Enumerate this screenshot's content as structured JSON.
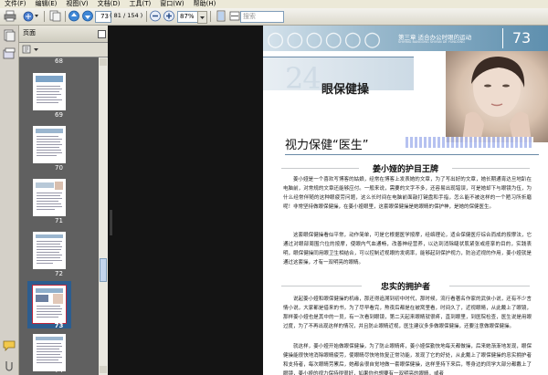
{
  "menu": [
    "文件(F)",
    "编辑(E)",
    "视图(V)",
    "文档(D)",
    "工具(T)",
    "窗口(W)",
    "帮助(H)"
  ],
  "toolbar": {
    "page_value": "73",
    "page_total": "( 81 / 154 )",
    "zoom_value": "87%",
    "search_placeholder": "搜索"
  },
  "panel": {
    "title": "页面",
    "thumbnails": [
      {
        "label": "68",
        "selected": false
      },
      {
        "label": "69",
        "selected": false
      },
      {
        "label": "70",
        "selected": false
      },
      {
        "label": "71",
        "selected": false
      },
      {
        "label": "72",
        "selected": false
      },
      {
        "label": "73",
        "selected": true
      },
      {
        "label": "74",
        "selected": false
      }
    ]
  },
  "document": {
    "chapter": "第三章  适合办公时眼的运动",
    "chapter_sub": "SHIYING BANGONG SHIYAN DE YUNDONG",
    "page_number": "73",
    "section_number": "24",
    "section_title": "眼保健操",
    "heading": "视力保健“医生”",
    "sub1": "姜小娅的护目王牌",
    "para1": "姜小娅是一个喜欢写博客的姑娘，经常在博客上发表她的文章，为了写出好的文章，她长期通宵达旦地趴在电脑前，对常规的文章还能够应付。一般来说，需要的文字不多，还容易出现错误，可是她却下与眼镜为伍，为什么经常伴随的这种眼疲劳问题，这么长时间在电脑前面敲打键盘和手指，怎么能不被这样的一个陋习所折磨呢！非常坚持做眼保健操，在姜小娅眼里，这套眼保健操是她眼睛的保护神，是她的保健医生。",
    "para2": "这套眼保健操看似平常，动作简单，可是它根据医学按摩，经络理论，适合保健医疗综合而成的按摩法，它通过对眼部周围穴位的按摩，使眼内气血通畅，改善神经营养，以达到消除睫状肌紧张或痉挛的目的，实践表明，眼保健操同用眼卫生相结合，可以控制近视眼的发病率，能够起到保护视力，防治近视的作用，姜小娅就是通过这套操，才有一双明亮的眼睛。",
    "sub2": "忠实的拥护者",
    "para3": "说起姜小娅和眼保健操的机缘，那还得追溯到初中时代，那时候，流行看著名作家的武侠小说，还有不少言情小说，大家都是借来的书，为了尽早看完，熬夜后都是在被窝里看，时间久了，近视眼睛，从此戴上了眼镜，那样姜小娅也是其中的一员，有一次看到眼镜，第二天起来眼睛就很疼，直到眼里，到医院检查，医生说是用眼过度，为了不再出现这样的情况，并且防止眼睛近视，医生建议多多做眼保健操，还要注意做眼保健操。",
    "para4": "就这样，姜小娅开始做眼保健操，为了防止眼睛疼，姜小娅保勤快地每天都做操，后来她渐渐地发现，眼保健操能很快地消除眼睛疲劳，使眼睛尽快地恢复正常功能，发现了它的好处，从此戴上了眼保健操的忠实拥护者和支持者，每次眼睛劳累后，她都会很自觉地做一套眼保健操，这样坚持下来后，等身边的同学大部分都戴上了眼镜，姜小娅的视力保持得很好，如果你也想要有一双明亮的眼睛，或者"
  }
}
